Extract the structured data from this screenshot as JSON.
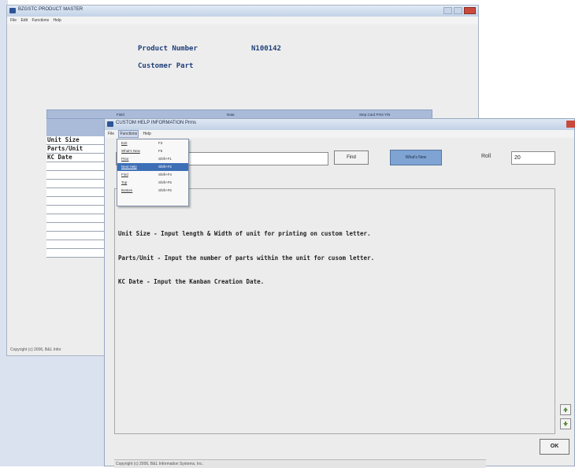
{
  "background_window": {
    "title": "BZGSTC  PRODUCT MASTER",
    "menu": [
      "File",
      "Edit",
      "Functions",
      "Help"
    ],
    "product_number_label": "Product Number",
    "product_number_value": "N100142",
    "customer_part_label": "Customer Part",
    "grid_headers": [
      "Field",
      "Data",
      "Step Card Print Y/N"
    ],
    "row_labels": [
      "Unit Size",
      "Parts/Unit",
      "KC Date",
      "",
      "",
      "",
      "",
      "",
      "",
      "",
      "",
      "",
      "",
      ""
    ],
    "copyright": "Copyright (c) 2006, B&L Infor"
  },
  "dialog": {
    "title": "CUSTOM HELP INFORMATION  Prms",
    "menu": [
      "File",
      "Functions",
      "Help"
    ],
    "find_label": "Find",
    "whats_new_label": "What's New",
    "roll_label": "Roll",
    "roll_value": "20",
    "help_lines": [
      "Unit Size - Input length & Width of unit for printing on custom letter.",
      "Parts/Unit - Input the number of parts within the unit for cusom letter.",
      "KC Date - Input the Kanban Creation Date."
    ],
    "ok_label": "OK",
    "status": "Copyright (c) 2006, B&L Information Systems, Inc."
  },
  "functions_menu": {
    "items": [
      {
        "label": "Exit",
        "shortcut": "F3"
      },
      {
        "label": "What's New",
        "shortcut": "F5"
      },
      {
        "label": "Prior",
        "shortcut": "Shift+F1"
      },
      {
        "label": "Next Help",
        "shortcut": "Shift+F2"
      },
      {
        "label": "Find",
        "shortcut": "Shift+F4"
      },
      {
        "label": "Top",
        "shortcut": "Shift+F5"
      },
      {
        "label": "Bottom",
        "shortcut": "Shift+F6"
      }
    ],
    "selected_index": 3
  },
  "icons": {
    "window_icon": "app-window-icon",
    "scroll_up": "arrow-up-icon",
    "scroll_down": "arrow-down-icon"
  },
  "colors": {
    "label_blue": "#1f3f7a",
    "grid_header": "#a9bbd8",
    "whats_new_button": "#7fa3d2",
    "menu_selection": "#3d6fb6"
  }
}
